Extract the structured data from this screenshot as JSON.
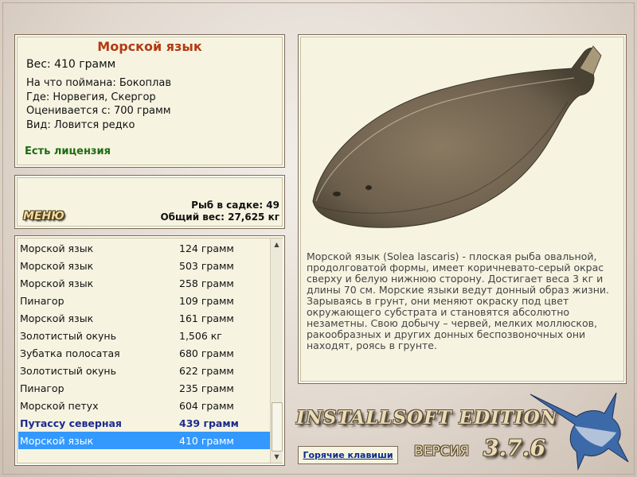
{
  "fish_info": {
    "title": "Морской язык",
    "weight": "Вес: 410 грамм",
    "caught_with": "На что поймана: Бокоплав",
    "location": "Где: Норвегия, Скергор",
    "valued_from": "Оценивается с: 700 грамм",
    "rarity": "Вид: Ловится редко",
    "license": "Есть лицензия"
  },
  "stats": {
    "menu_label": "МЕНЮ",
    "fish_in_keepnet": "Рыб в садке: 49",
    "total_weight": "Общий вес: 27,625 кг"
  },
  "fish_list": [
    {
      "name": "Морской язык",
      "weight": "124 грамм"
    },
    {
      "name": "Морской язык",
      "weight": "503 грамм"
    },
    {
      "name": "Морской язык",
      "weight": "258 грамм"
    },
    {
      "name": "Пинагор",
      "weight": "109 грамм"
    },
    {
      "name": "Морской язык",
      "weight": "161 грамм"
    },
    {
      "name": "Золотистый окунь",
      "weight": "1,506 кг"
    },
    {
      "name": "Зубатка полосатая",
      "weight": "680 грамм"
    },
    {
      "name": "Золотистый окунь",
      "weight": "622 грамм"
    },
    {
      "name": "Пинагор",
      "weight": "235 грамм"
    },
    {
      "name": "Морской петух",
      "weight": "604 грамм"
    },
    {
      "name": "Путассу северная",
      "weight": "439 грамм"
    },
    {
      "name": "Морской язык",
      "weight": "410 грамм"
    }
  ],
  "description": "Морской язык (Solea lascaris) - плоская рыба овальной, продолговатой формы, имеет коричневато-серый окрас сверху и белую нижнюю сторону. Достигает веса 3 кг и длины 70 см. Морские языки ведут донный образ жизни. Зарываясь в грунт, они меняют окраску под цвет окружающего субстрата и становятся абсолютно незаметны. Свою добычу – червей, мелких моллюсков, ракообразных и других донных беспозвоночных они находят, роясь в грунте.",
  "branding": {
    "edition": "INSTALLSOFT EDITION",
    "version_label": "ВЕРСИЯ",
    "version_number": "3.7.6"
  },
  "hotkeys_label": "Горячие клавиши",
  "icons": {
    "scroll_up": "arrow-up-icon",
    "scroll_down": "arrow-down-icon",
    "logo": "marlin-icon"
  },
  "colors": {
    "title": "#b33a12",
    "license": "#1f6b12",
    "selection": "#3399ff",
    "highlight_row": "#1c2a8e",
    "panel": "#f6f4e1"
  }
}
